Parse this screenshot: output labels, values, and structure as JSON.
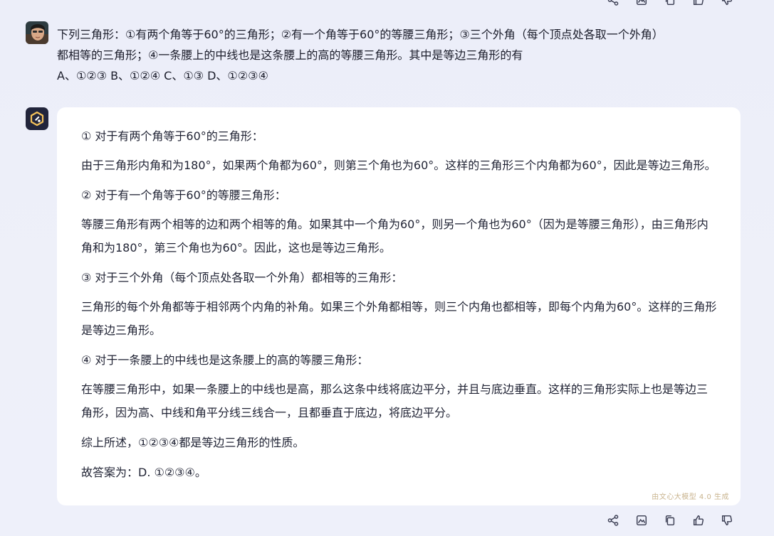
{
  "question": {
    "line1": "下列三角形：①有两个角等于60°的三角形；②有一个角等于60°的等腰三角形；③三个外角（每个顶点处各取一个外角）",
    "line2": "都相等的三角形；④一条腰上的中线也是这条腰上的高的等腰三角形。其中是等边三角形的有",
    "line3": "A、①②③ B、①②④ C、①③ D、①②③④"
  },
  "answer": {
    "p1_head": "① 对于有两个角等于60°的三角形：",
    "p1_body": "由于三角形内角和为180°，如果两个角都为60°，则第三个角也为60°。这样的三角形三个内角都为60°，因此是等边三角形。",
    "p2_head": "② 对于有一个角等于60°的等腰三角形：",
    "p2_body": "等腰三角形有两个相等的边和两个相等的角。如果其中一个角为60°，则另一个角也为60°（因为是等腰三角形），由三角形内角和为180°，第三个角也为60°。因此，这也是等边三角形。",
    "p3_head": "③ 对于三个外角（每个顶点处各取一个外角）都相等的三角形：",
    "p3_body": "三角形的每个外角都等于相邻两个内角的补角。如果三个外角都相等，则三个内角也都相等，即每个内角为60°。这样的三角形是等边三角形。",
    "p4_head": "④ 对于一条腰上的中线也是这条腰上的高的等腰三角形：",
    "p4_body": "在等腰三角形中，如果一条腰上的中线也是高，那么这条中线将底边平分，并且与底边垂直。这样的三角形实际上也是等边三角形，因为高、中线和角平分线三线合一，且都垂直于底边，将底边平分。",
    "summary": "综上所述，①②③④都是等边三角形的性质。",
    "final": "故答案为：D. ①②③④。",
    "watermark": "由文心大模型 4.0 生成"
  },
  "icons": {
    "share": "share-icon",
    "image": "image-icon",
    "copy": "copy-icon",
    "like": "thumbs-up-icon",
    "dislike": "thumbs-down-icon"
  },
  "colors": {
    "background": "#eceef9",
    "card": "#ffffff",
    "text": "#1f2233",
    "watermark": "#c9b48f",
    "bot_avatar_bg": "#22253b",
    "bot_avatar_accent": "#f3c15a"
  }
}
